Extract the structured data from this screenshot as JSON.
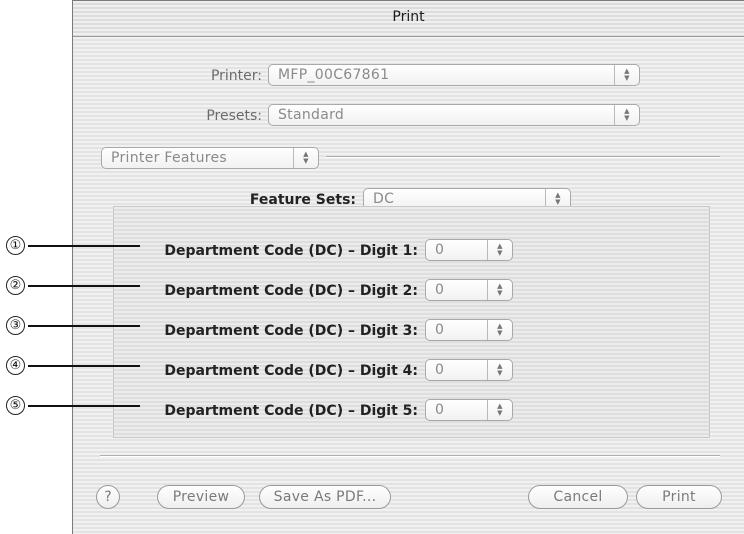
{
  "window": {
    "title": "Print"
  },
  "printer": {
    "label": "Printer:",
    "value": "MFP_00C67861"
  },
  "presets": {
    "label": "Presets:",
    "value": "Standard"
  },
  "pane": {
    "value": "Printer Features"
  },
  "feature_sets": {
    "label": "Feature Sets:",
    "value": "DC"
  },
  "digits": [
    {
      "callout": "①",
      "label": "Department Code (DC) – Digit 1:",
      "value": "0"
    },
    {
      "callout": "②",
      "label": "Department Code (DC) – Digit 2:",
      "value": "0"
    },
    {
      "callout": "③",
      "label": "Department Code (DC) – Digit 3:",
      "value": "0"
    },
    {
      "callout": "④",
      "label": "Department Code (DC) – Digit 4:",
      "value": "0"
    },
    {
      "callout": "⑤",
      "label": "Department Code (DC) – Digit 5:",
      "value": "0"
    }
  ],
  "buttons": {
    "help": "?",
    "preview": "Preview",
    "save_pdf": "Save As PDF...",
    "cancel": "Cancel",
    "print": "Print"
  },
  "icons": {
    "popup_arrows": "up-down-arrows-icon",
    "help": "help-icon"
  }
}
